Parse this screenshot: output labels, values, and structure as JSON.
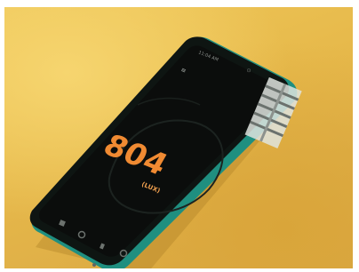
{
  "scene": {
    "description_subject": "smartphone-lux-meter",
    "colors": {
      "background": "#e8bd50",
      "phone_body": "#0e1512",
      "phone_edge": "#1f8f80",
      "screen": "#0b0d0c",
      "reading": "#f08a32",
      "unit": "#f2a150"
    }
  },
  "lux_meter": {
    "value": "804",
    "unit": "(LUX)"
  },
  "status_bar": {
    "time": "11:04 AM",
    "indicator": "⊙"
  },
  "toolbar": {
    "left_glyph": "≡"
  },
  "bottom_bar": {
    "icons": [
      "stats-icon",
      "timer-icon",
      "info-icon",
      "refresh-icon"
    ]
  },
  "icons": {
    "home_dot": "home-dot-icon"
  }
}
